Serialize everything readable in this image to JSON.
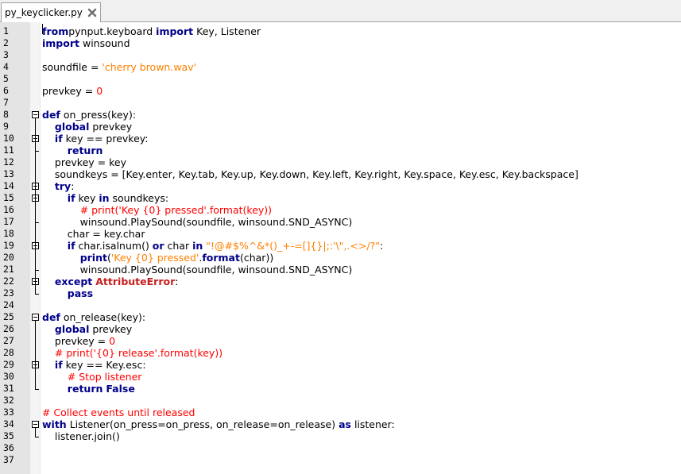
{
  "tab": {
    "title": "py_keyclicker.py",
    "close_icon": "close-x-icon"
  },
  "lines": [
    {
      "n": "1",
      "t": [
        [
          "kw",
          "from"
        ],
        [
          "",
          "pynput.keyboard "
        ],
        [
          "kw",
          "import"
        ],
        [
          "",
          " Key, Listener"
        ]
      ]
    },
    {
      "n": "2",
      "t": [
        [
          "kw",
          "import"
        ],
        [
          "",
          " winsound"
        ]
      ]
    },
    {
      "n": "3",
      "t": []
    },
    {
      "n": "4",
      "t": [
        [
          "",
          "soundfile = "
        ],
        [
          "str",
          "'cherry brown.wav'"
        ]
      ]
    },
    {
      "n": "5",
      "t": []
    },
    {
      "n": "6",
      "t": [
        [
          "",
          "prevkey = "
        ],
        [
          "num",
          "0"
        ]
      ]
    },
    {
      "n": "7",
      "t": []
    },
    {
      "n": "8",
      "t": [
        [
          "kw",
          "def"
        ],
        [
          "",
          " on_press(key):"
        ]
      ]
    },
    {
      "n": "9",
      "t": [
        [
          "",
          "    "
        ],
        [
          "kw",
          "global"
        ],
        [
          "",
          " prevkey"
        ]
      ]
    },
    {
      "n": "10",
      "t": [
        [
          "",
          "    "
        ],
        [
          "kw",
          "if"
        ],
        [
          "",
          " key == prevkey:"
        ]
      ]
    },
    {
      "n": "11",
      "t": [
        [
          "",
          "        "
        ],
        [
          "kw",
          "return"
        ]
      ]
    },
    {
      "n": "12",
      "t": [
        [
          "",
          "    prevkey = key"
        ]
      ]
    },
    {
      "n": "13",
      "t": [
        [
          "",
          "    soundkeys = [Key.enter, Key.tab, Key.up, Key.down, Key.left, Key.right, Key.space, Key.esc, Key.backspace]"
        ]
      ]
    },
    {
      "n": "14",
      "t": [
        [
          "",
          "    "
        ],
        [
          "kw",
          "try"
        ],
        [
          "",
          ":"
        ]
      ]
    },
    {
      "n": "15",
      "t": [
        [
          "",
          "        "
        ],
        [
          "kw",
          "if"
        ],
        [
          "",
          " key "
        ],
        [
          "kw",
          "in"
        ],
        [
          "",
          " soundkeys:"
        ]
      ]
    },
    {
      "n": "16",
      "t": [
        [
          "",
          "            "
        ],
        [
          "cmt",
          "# print('Key {0} pressed'.format(key))"
        ]
      ]
    },
    {
      "n": "17",
      "t": [
        [
          "",
          "            winsound.PlaySound(soundfile, winsound.SND_ASYNC)"
        ]
      ]
    },
    {
      "n": "18",
      "t": [
        [
          "",
          "        char = key.char"
        ]
      ]
    },
    {
      "n": "19",
      "t": [
        [
          "",
          "        "
        ],
        [
          "kw",
          "if"
        ],
        [
          "",
          " char.isalnum() "
        ],
        [
          "kw",
          "or"
        ],
        [
          "",
          " char "
        ],
        [
          "kw",
          "in"
        ],
        [
          "str",
          " \"!@#$%^&*()_+-=[]{}|;:'\\\",.<>/?\""
        ],
        [
          "",
          ":"
        ]
      ]
    },
    {
      "n": "20",
      "t": [
        [
          "",
          "            "
        ],
        [
          "kw",
          "print"
        ],
        [
          "",
          "("
        ],
        [
          "str",
          "'Key {0} pressed'"
        ],
        [
          "",
          "."
        ],
        [
          "kw",
          "format"
        ],
        [
          "",
          "(char))"
        ]
      ]
    },
    {
      "n": "21",
      "t": [
        [
          "",
          "            winsound.PlaySound(soundfile, winsound.SND_ASYNC)"
        ]
      ]
    },
    {
      "n": "22",
      "t": [
        [
          "",
          "    "
        ],
        [
          "kw",
          "except"
        ],
        [
          "",
          " "
        ],
        [
          "exc",
          "AttributeError"
        ],
        [
          "",
          ":"
        ]
      ]
    },
    {
      "n": "23",
      "t": [
        [
          "",
          "        "
        ],
        [
          "kw",
          "pass"
        ]
      ]
    },
    {
      "n": "24",
      "t": []
    },
    {
      "n": "25",
      "t": [
        [
          "kw",
          "def"
        ],
        [
          "",
          " on_release(key):"
        ]
      ]
    },
    {
      "n": "26",
      "t": [
        [
          "",
          "    "
        ],
        [
          "kw",
          "global"
        ],
        [
          "",
          " prevkey"
        ]
      ]
    },
    {
      "n": "27",
      "t": [
        [
          "",
          "    prevkey = "
        ],
        [
          "num",
          "0"
        ]
      ]
    },
    {
      "n": "28",
      "t": [
        [
          "",
          "    "
        ],
        [
          "cmt",
          "# print('{0} release'.format(key))"
        ]
      ]
    },
    {
      "n": "29",
      "t": [
        [
          "",
          "    "
        ],
        [
          "kw",
          "if"
        ],
        [
          "",
          " key == Key.esc:"
        ]
      ]
    },
    {
      "n": "30",
      "t": [
        [
          "",
          "        "
        ],
        [
          "cmt",
          "# Stop listener"
        ]
      ]
    },
    {
      "n": "31",
      "t": [
        [
          "",
          "        "
        ],
        [
          "kw",
          "return"
        ],
        [
          "",
          " "
        ],
        [
          "kw",
          "False"
        ]
      ]
    },
    {
      "n": "32",
      "t": []
    },
    {
      "n": "33",
      "t": [
        [
          "cmt",
          "# Collect events until released"
        ]
      ]
    },
    {
      "n": "34",
      "t": [
        [
          "kw",
          "with"
        ],
        [
          "",
          " Listener(on_press=on_press, on_release=on_release) "
        ],
        [
          "kw",
          "as"
        ],
        [
          "",
          " listener:"
        ]
      ]
    },
    {
      "n": "35",
      "t": [
        [
          "",
          "    listener.join()"
        ]
      ]
    },
    {
      "n": "36",
      "t": []
    },
    {
      "n": "37",
      "t": []
    }
  ],
  "folds": [
    "8",
    "10",
    "14",
    "15",
    "19",
    "22",
    "25",
    "29",
    "34"
  ],
  "colors": {
    "keyword": "#00008b",
    "string": "#ff8000",
    "comment": "#ff0000",
    "number": "#ff0000",
    "exception": "#c81e1e"
  }
}
